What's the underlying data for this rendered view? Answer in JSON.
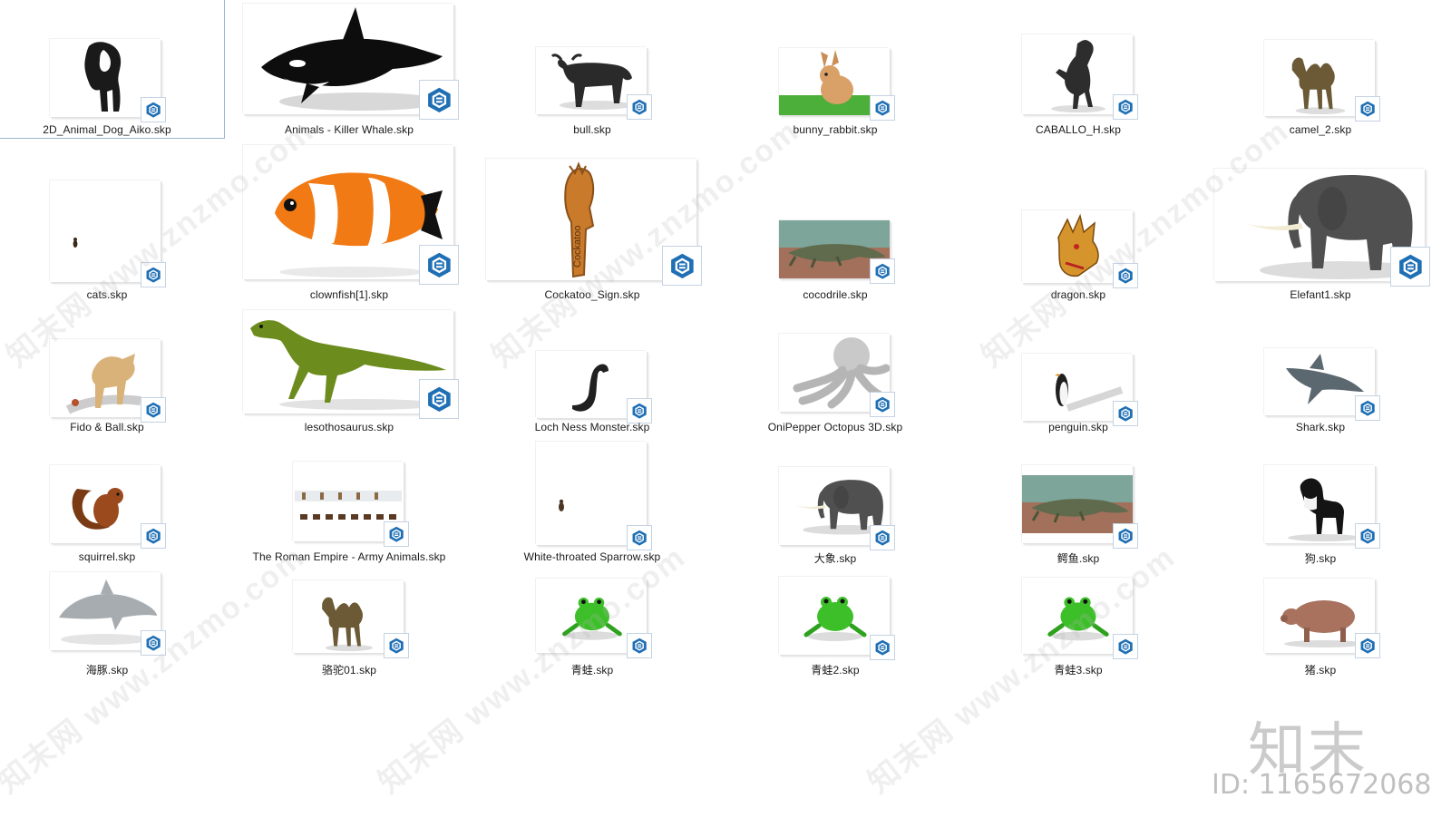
{
  "files": [
    {
      "name": "2D_Animal_Dog_Aiko.skp",
      "icon": "dog-silhouette-icon"
    },
    {
      "name": "Animals - Killer Whale.skp",
      "icon": "killer-whale-icon"
    },
    {
      "name": "bull.skp",
      "icon": "bull-icon"
    },
    {
      "name": "bunny_rabbit.skp",
      "icon": "rabbit-icon"
    },
    {
      "name": "CABALLO_H.skp",
      "icon": "horse-icon"
    },
    {
      "name": "camel_2.skp",
      "icon": "camel-icon"
    },
    {
      "name": "cats.skp",
      "icon": "cat-icon"
    },
    {
      "name": "clownfish[1].skp",
      "icon": "clownfish-icon"
    },
    {
      "name": "Cockatoo_Sign.skp",
      "icon": "cockatoo-sign-icon",
      "sign_text": "Cockatoo"
    },
    {
      "name": "cocodrile.skp",
      "icon": "crocodile-icon"
    },
    {
      "name": "dragon.skp",
      "icon": "dragon-icon"
    },
    {
      "name": "Elefant1.skp",
      "icon": "elephant-icon"
    },
    {
      "name": "Fido & Ball.skp",
      "icon": "dog-with-ball-icon"
    },
    {
      "name": "lesothosaurus.skp",
      "icon": "dinosaur-icon"
    },
    {
      "name": "Loch Ness Monster.skp",
      "icon": "loch-ness-monster-icon"
    },
    {
      "name": "OniPepper Octopus 3D.skp",
      "icon": "octopus-icon"
    },
    {
      "name": "penguin.skp",
      "icon": "penguin-icon"
    },
    {
      "name": "Shark.skp",
      "icon": "shark-icon"
    },
    {
      "name": "squirrel.skp",
      "icon": "squirrel-icon"
    },
    {
      "name": "The Roman Empire - Army Animals.skp",
      "icon": "army-animals-icon"
    },
    {
      "name": "White-throated Sparrow.skp",
      "icon": "sparrow-icon"
    },
    {
      "name": "大象.skp",
      "icon": "elephant-icon"
    },
    {
      "name": "鳄鱼.skp",
      "icon": "crocodile-icon"
    },
    {
      "name": "狗.skp",
      "icon": "dog-icon"
    },
    {
      "name": "海豚.skp",
      "icon": "dolphin-icon"
    },
    {
      "name": "骆驼01.skp",
      "icon": "camel-icon"
    },
    {
      "name": "青蛙.skp",
      "icon": "frog-icon"
    },
    {
      "name": "青蛙2.skp",
      "icon": "frog-icon"
    },
    {
      "name": "青蛙3.skp",
      "icon": "frog-icon"
    },
    {
      "name": "猪.skp",
      "icon": "pig-icon"
    }
  ],
  "selected_file": "2D_Animal_Dog_Aiko.skp",
  "file_badge_icon": "sketchup-file-icon",
  "watermark_text": "知末网 www.znzmo.com",
  "brand_logo": "知末",
  "brand_id": "ID: 1165672068",
  "colors": {
    "selection_border": "#99b4d1",
    "sketchup_blue": "#1f6fb5",
    "label_text": "#1a1a1a"
  }
}
